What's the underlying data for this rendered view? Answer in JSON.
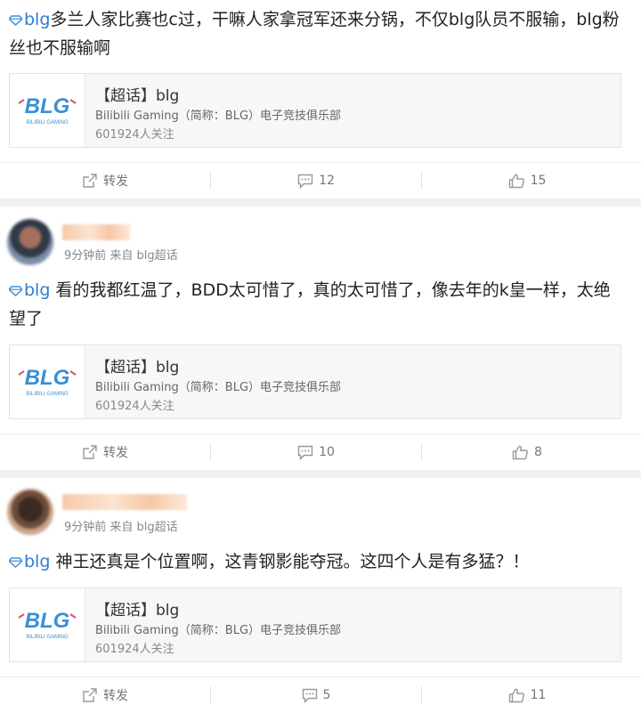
{
  "posts": [
    {
      "text_tag": "blg",
      "text": "多兰人家比赛也c过，干嘛人家拿冠军还来分锅，不仅blg队员不服输，blg粉丝也不服输啊",
      "card": {
        "title": "【超话】blg",
        "desc": "Bilibili Gaming（简称：BLG）电子竞技俱乐部",
        "followers": "601924人关注",
        "logo_text": "BLG",
        "logo_sub": "BILIBILI GAMING"
      },
      "actions": {
        "repost": "转发",
        "comments": "12",
        "likes": "15"
      }
    },
    {
      "username": "··········",
      "meta": "9分钟前 来自 blg超话",
      "text_tag": "blg",
      "text": " 看的我都红温了，BDD太可惜了，真的太可惜了，像去年的k皇一样，太绝望了",
      "card": {
        "title": "【超话】blg",
        "desc": "Bilibili Gaming（简称：BLG）电子竞技俱乐部",
        "followers": "601924人关注",
        "logo_text": "BLG",
        "logo_sub": "BILIBILI GAMING"
      },
      "actions": {
        "repost": "转发",
        "comments": "10",
        "likes": "8"
      }
    },
    {
      "username": "···············",
      "meta": "9分钟前 来自 blg超话",
      "text_tag": "blg",
      "text": " 神王还真是个位置啊，这青钢影能夺冠。这四个人是有多猛？！",
      "card": {
        "title": "【超话】blg",
        "desc": "Bilibili Gaming（简称：BLG）电子竞技俱乐部",
        "followers": "601924人关注",
        "logo_text": "BLG",
        "logo_sub": "BILIBILI GAMING"
      },
      "actions": {
        "repost": "转发",
        "comments": "5",
        "likes": "11"
      }
    }
  ],
  "colors": {
    "link": "#2c7fd3",
    "logo": "#3a8fd6",
    "logo_accent": "#e44c6e",
    "bg": "#eef0f3"
  }
}
